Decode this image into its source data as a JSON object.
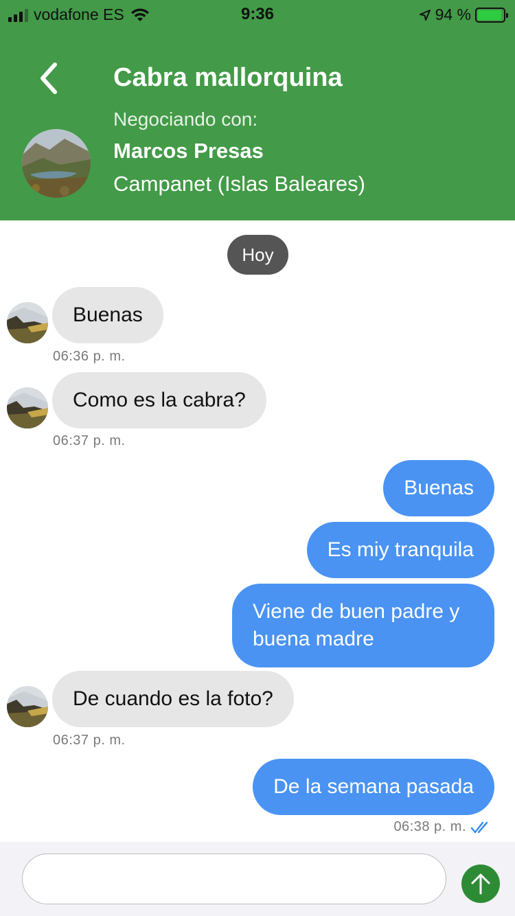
{
  "status_bar": {
    "carrier": "vodafone ES",
    "time": "9:36",
    "battery_percent": "94 %",
    "battery_level": 0.94,
    "icons": [
      "signal-icon",
      "wifi-icon",
      "location-arrow-icon",
      "battery-charging-icon"
    ]
  },
  "header": {
    "title": "Cabra mallorquina",
    "subtitle": "Negociando con:",
    "seller_name": "Marcos Presas",
    "seller_location": "Campanet (Islas Baleares)",
    "back_icon": "chevron-left-icon"
  },
  "chat": {
    "day_label": "Hoy",
    "messages": [
      {
        "text": "Buenas",
        "time": "06:36 p. m."
      },
      {
        "text": "Como es la cabra?",
        "time": "06:37 p. m."
      },
      {
        "text": "Buenas"
      },
      {
        "text": "Es miy tranquila"
      },
      {
        "text": "Viene de buen padre y buena madre"
      },
      {
        "text": "De cuando es la foto?",
        "time": "06:37 p. m."
      },
      {
        "text": "De la semana pasada",
        "time": "06:38 p. m."
      }
    ],
    "read_icon": "double-check-icon"
  },
  "composer": {
    "value": "",
    "placeholder": "",
    "send_icon": "arrow-up-icon"
  },
  "colors": {
    "header_green": "#439a48",
    "incoming_bubble": "#e6e6e6",
    "outgoing_bubble": "#4a93f3",
    "send_button": "#2e8b35",
    "read_check": "#3a8ef0"
  }
}
